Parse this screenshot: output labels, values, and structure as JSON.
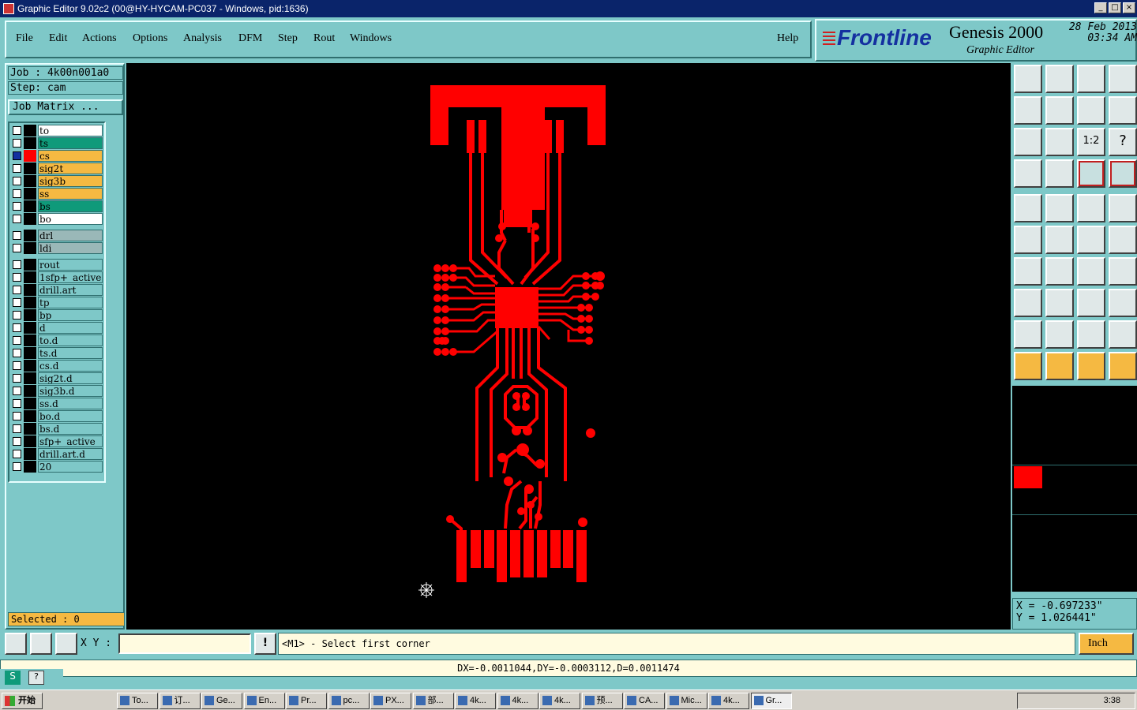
{
  "window": {
    "title": "Graphic Editor 9.02c2 (00@HY-HYCAM-PC037 - Windows, pid:1636)"
  },
  "menu": [
    "File",
    "Edit",
    "Actions",
    "Options",
    "Analysis",
    "DFM",
    "Step",
    "Rout",
    "Windows"
  ],
  "help": "Help",
  "brand": {
    "logo": "Frontline",
    "product": "Genesis 2000",
    "subtitle": "Graphic Editor",
    "date": "28 Feb 2013",
    "time": "03:34 AM"
  },
  "job": {
    "job_line": "Job : 4k00n001a0",
    "step_line": "Step: cam",
    "matrix_button": "Job Matrix ..."
  },
  "layers_group1": [
    {
      "name": "to",
      "color": "#ffffff"
    },
    {
      "name": "ts",
      "color": "#0f9a7a"
    },
    {
      "name": "cs",
      "color": "#f5b942",
      "active": true
    },
    {
      "name": "sig2t",
      "color": "#f5b942"
    },
    {
      "name": "sig3b",
      "color": "#f5b942"
    },
    {
      "name": "ss",
      "color": "#f5b942"
    },
    {
      "name": "bs",
      "color": "#0f9a7a"
    },
    {
      "name": "bo",
      "color": "#ffffff"
    }
  ],
  "layers_group2": [
    {
      "name": "drl",
      "color": "#9ab8b8"
    },
    {
      "name": "ldi",
      "color": "#9ab8b8"
    }
  ],
  "layers_group3": [
    {
      "name": "rout"
    },
    {
      "name": "1sfp+_active"
    },
    {
      "name": "drill.art"
    },
    {
      "name": "tp"
    },
    {
      "name": "bp"
    },
    {
      "name": "d"
    },
    {
      "name": "to.d"
    },
    {
      "name": "ts.d"
    },
    {
      "name": "cs.d"
    },
    {
      "name": "sig2t.d"
    },
    {
      "name": "sig3b.d"
    },
    {
      "name": "ss.d"
    },
    {
      "name": "bo.d"
    },
    {
      "name": "bs.d"
    },
    {
      "name": "sfp+_active"
    },
    {
      "name": "drill.art.d"
    },
    {
      "name": "20"
    }
  ],
  "selected": "Selected : 0",
  "coords": {
    "x": "X = -0.697233\"",
    "y": "Y = 1.026441\""
  },
  "command": {
    "xy_label": "X Y :",
    "prompt": "<M1> - Select first corner",
    "unit": "Inch"
  },
  "status": "DX=-0.0011044,DY=-0.0003112,D=0.0011474",
  "taskbar": {
    "start": "开始",
    "tasks": [
      "To...",
      "订...",
      "Ge...",
      "En...",
      "Pr...",
      "pc...",
      "PX...",
      "部...",
      "4k...",
      "4k...",
      "4k...",
      "预...",
      "CA...",
      "Mic...",
      "4k...",
      "Gr..."
    ],
    "clock": "3:38"
  },
  "colors": {
    "trace": "#ff0000",
    "canvas": "#000000",
    "panel": "#7ec8c8"
  }
}
